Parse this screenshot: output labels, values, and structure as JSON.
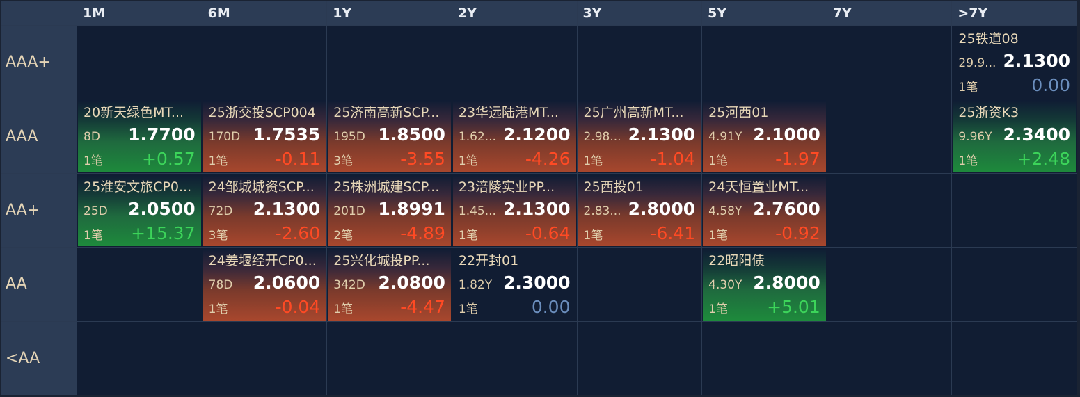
{
  "columns": [
    "1M",
    "6M",
    "1Y",
    "2Y",
    "3Y",
    "5Y",
    "7Y",
    ">7Y"
  ],
  "rows": [
    "AAA+",
    "AAA",
    "AA+",
    "AA",
    "<AA"
  ],
  "cards": [
    {
      "row": 0,
      "col": 7,
      "name": "25铁道08",
      "term": "29.9...",
      "yield": "2.1300",
      "count": "1笔",
      "change": "0.00",
      "trend": "zero"
    },
    {
      "row": 1,
      "col": 0,
      "name": "20新天绿色MT...",
      "term": "8D",
      "yield": "1.7700",
      "count": "1笔",
      "change": "+0.57",
      "trend": "pos"
    },
    {
      "row": 1,
      "col": 1,
      "name": "25浙交投SCP004",
      "term": "170D",
      "yield": "1.7535",
      "count": "1笔",
      "change": "-0.11",
      "trend": "neg"
    },
    {
      "row": 1,
      "col": 2,
      "name": "25济南高新SCP...",
      "term": "195D",
      "yield": "1.8500",
      "count": "3笔",
      "change": "-3.55",
      "trend": "neg"
    },
    {
      "row": 1,
      "col": 3,
      "name": "23华远陆港MT...",
      "term": "1.62...",
      "yield": "2.1200",
      "count": "1笔",
      "change": "-4.26",
      "trend": "neg"
    },
    {
      "row": 1,
      "col": 4,
      "name": "25广州高新MT...",
      "term": "2.98...",
      "yield": "2.1300",
      "count": "1笔",
      "change": "-1.04",
      "trend": "neg"
    },
    {
      "row": 1,
      "col": 5,
      "name": "25河西01",
      "term": "4.91Y",
      "yield": "2.1000",
      "count": "1笔",
      "change": "-1.97",
      "trend": "neg"
    },
    {
      "row": 1,
      "col": 7,
      "name": "25浙资K3",
      "term": "9.96Y",
      "yield": "2.3400",
      "count": "1笔",
      "change": "+2.48",
      "trend": "pos"
    },
    {
      "row": 2,
      "col": 0,
      "name": "25淮安文旅CP0...",
      "term": "25D",
      "yield": "2.0500",
      "count": "1笔",
      "change": "+15.37",
      "trend": "pos"
    },
    {
      "row": 2,
      "col": 1,
      "name": "24邹城城资SCP...",
      "term": "72D",
      "yield": "2.1300",
      "count": "3笔",
      "change": "-2.60",
      "trend": "neg"
    },
    {
      "row": 2,
      "col": 2,
      "name": "25株洲城建SCP...",
      "term": "201D",
      "yield": "1.8991",
      "count": "2笔",
      "change": "-4.89",
      "trend": "neg"
    },
    {
      "row": 2,
      "col": 3,
      "name": "23涪陵实业PP...",
      "term": "1.45...",
      "yield": "2.1300",
      "count": "1笔",
      "change": "-0.64",
      "trend": "neg"
    },
    {
      "row": 2,
      "col": 4,
      "name": "25西投01",
      "term": "2.83...",
      "yield": "2.8000",
      "count": "1笔",
      "change": "-6.41",
      "trend": "neg"
    },
    {
      "row": 2,
      "col": 5,
      "name": "24天恒置业MT...",
      "term": "4.58Y",
      "yield": "2.7600",
      "count": "1笔",
      "change": "-0.92",
      "trend": "neg"
    },
    {
      "row": 3,
      "col": 1,
      "name": "24姜堰经开CP0...",
      "term": "78D",
      "yield": "2.0600",
      "count": "1笔",
      "change": "-0.04",
      "trend": "neg"
    },
    {
      "row": 3,
      "col": 2,
      "name": "25兴化城投PP...",
      "term": "342D",
      "yield": "2.0800",
      "count": "1笔",
      "change": "-4.47",
      "trend": "neg"
    },
    {
      "row": 3,
      "col": 3,
      "name": "22开封01",
      "term": "1.82Y",
      "yield": "2.3000",
      "count": "1笔",
      "change": "0.00",
      "trend": "zero"
    },
    {
      "row": 3,
      "col": 5,
      "name": "22昭阳债",
      "term": "4.30Y",
      "yield": "2.8000",
      "count": "1笔",
      "change": "+5.01",
      "trend": "pos"
    }
  ]
}
